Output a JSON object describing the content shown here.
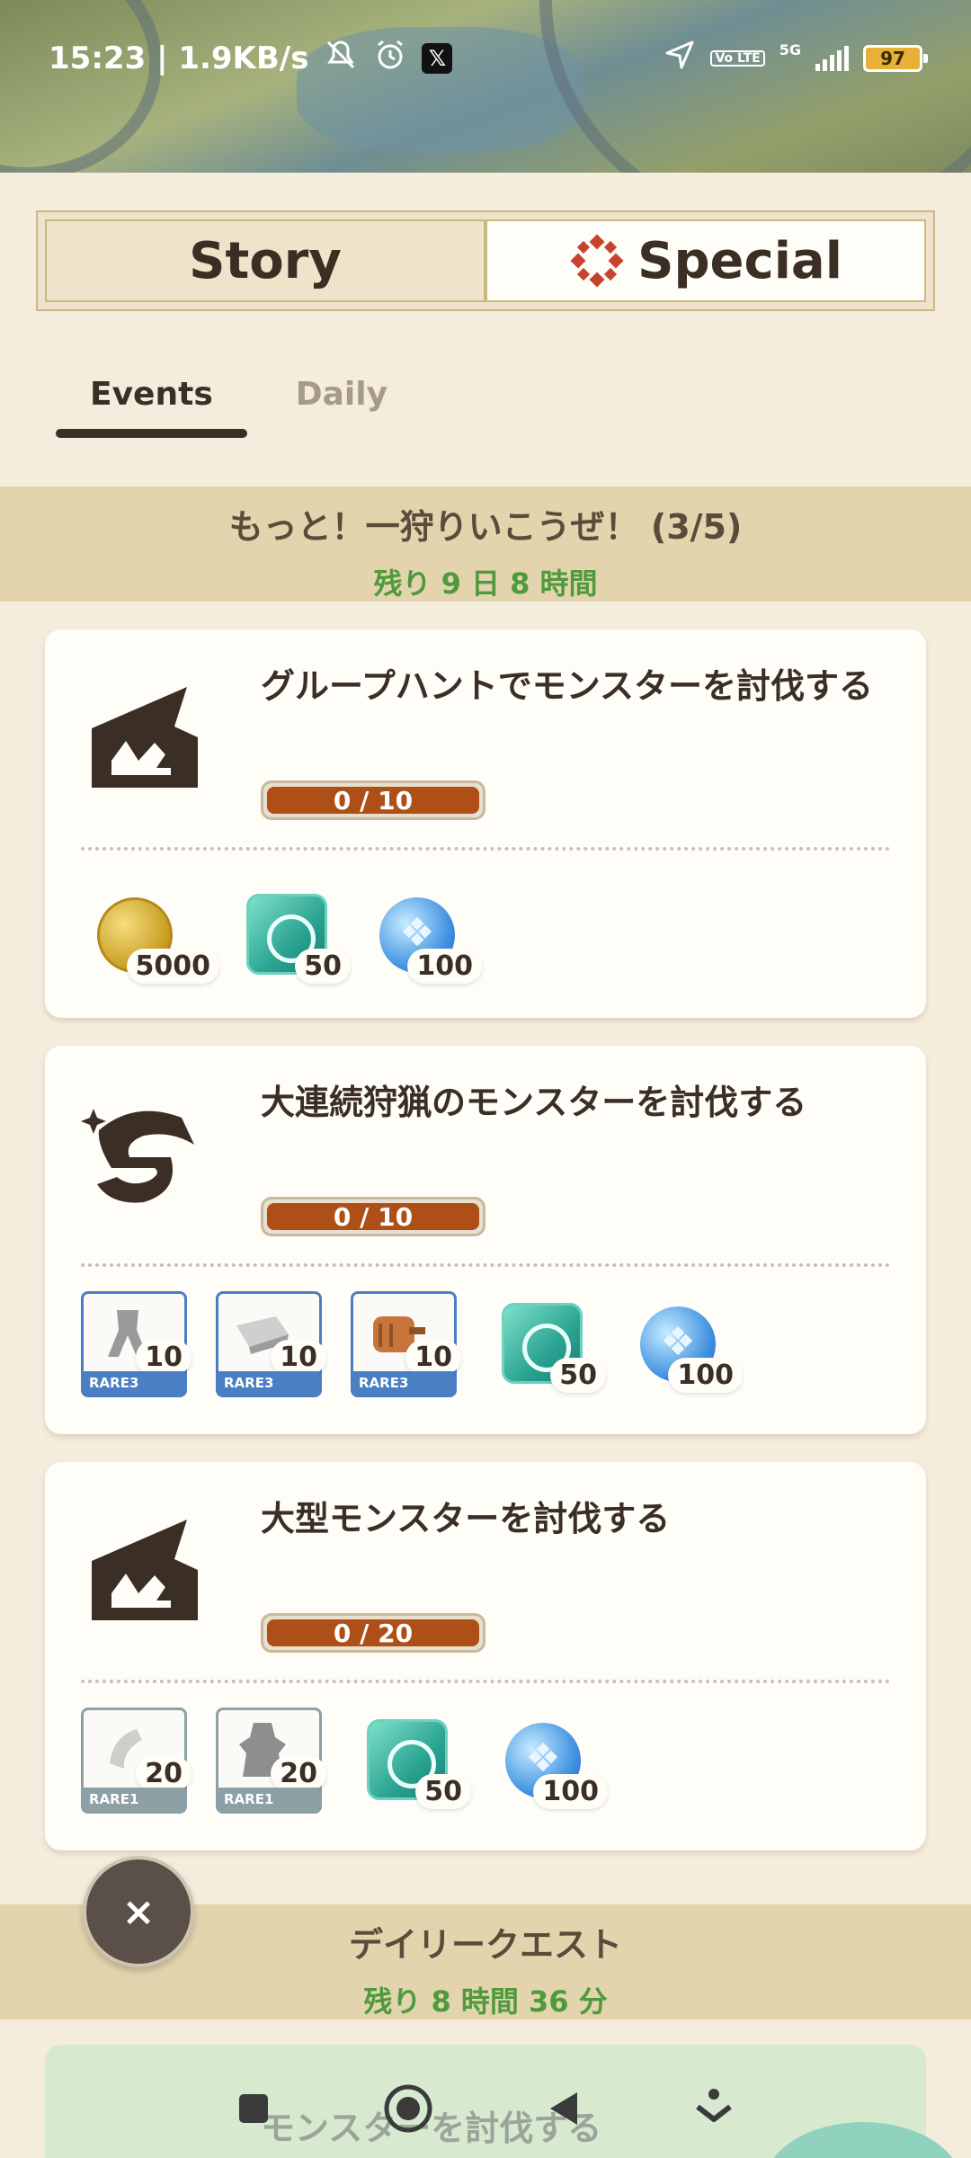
{
  "status": {
    "time_speed": "15:23 | 1.9KB/s",
    "x_label": "𝕏",
    "battery": "97",
    "volte": "Vo LTE",
    "network": "5G"
  },
  "segment": {
    "story": "Story",
    "special": "Special"
  },
  "subtabs": {
    "events": "Events",
    "daily": "Daily"
  },
  "event_section": {
    "title": "もっと！一狩りいこうぜ！ (3/5)",
    "time_left": "残り 9 日 8 時間"
  },
  "missions": [
    {
      "title": "グループハントでモンスターを討伐する",
      "progress": "0 / 10",
      "rewards": [
        "5000",
        "50",
        "100"
      ]
    },
    {
      "title": "大連続狩猟のモンスターを討伐する",
      "progress": "0 / 10",
      "rewards": [
        "10",
        "10",
        "10",
        "50",
        "100"
      ],
      "rarities": [
        "RARE3",
        "RARE3",
        "RARE3"
      ]
    },
    {
      "title": "大型モンスターを討伐する",
      "progress": "0 / 20",
      "rewards": [
        "20",
        "20",
        "50",
        "100"
      ],
      "rarities": [
        "RARE1",
        "RARE1"
      ]
    }
  ],
  "daily_section": {
    "title": "デイリークエスト",
    "time_left": "残り 8 時間 36 分"
  },
  "teaser": {
    "title": "モンスターを討伐する"
  },
  "close_label": "×",
  "colors": {
    "progress_fill": "#ad4f17",
    "time_green": "#4f9a3c",
    "section_band": "#e3d4ae",
    "special_red": "#c7432f"
  }
}
